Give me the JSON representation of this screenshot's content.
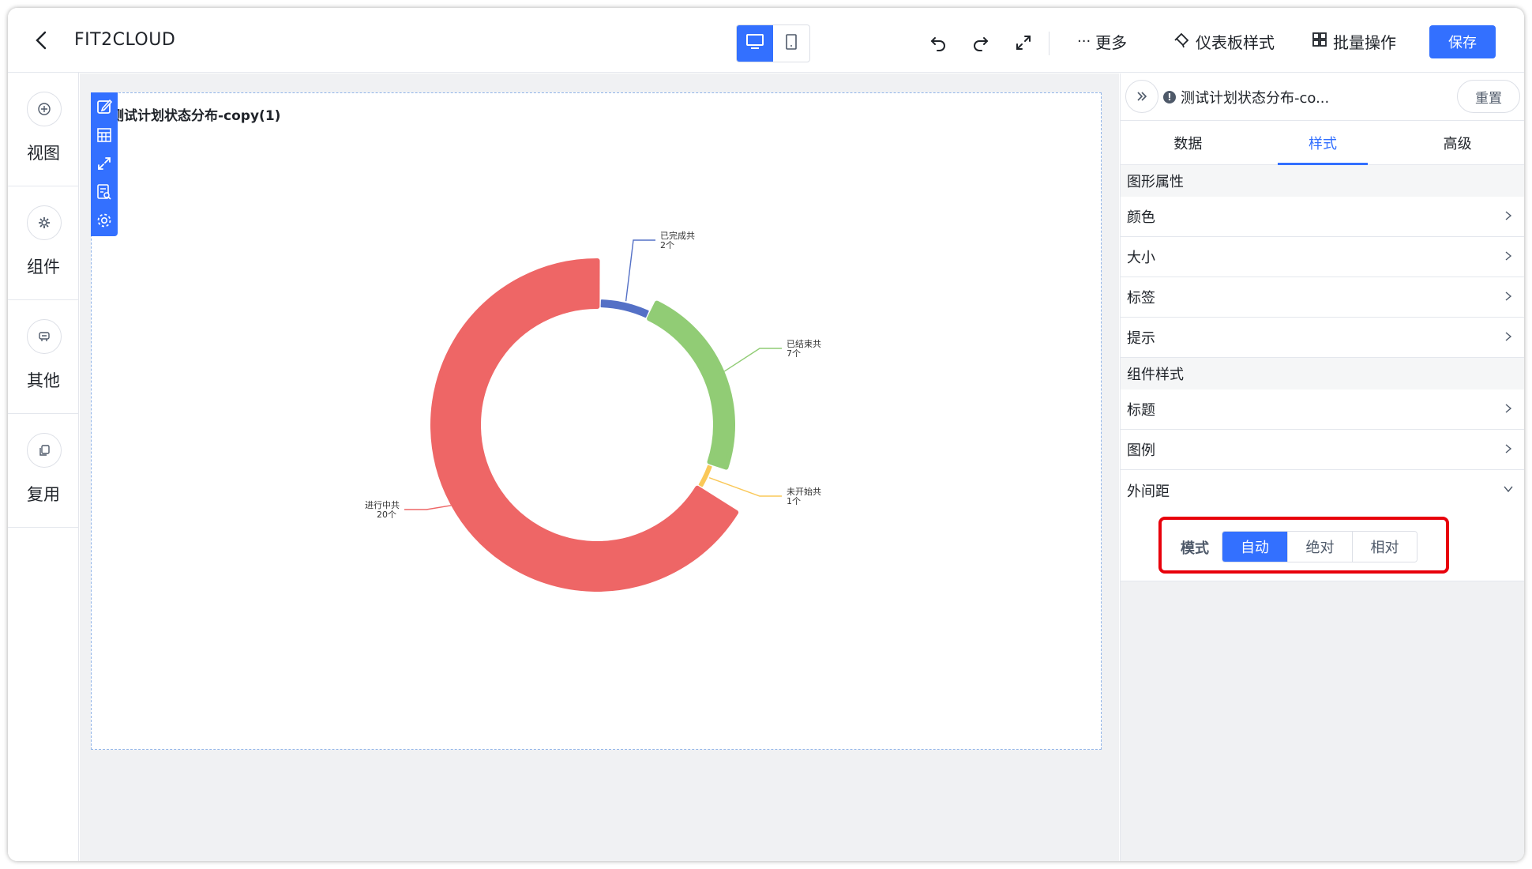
{
  "header": {
    "app_title": "FIT2CLOUD",
    "more_label": "更多",
    "dashboard_style_label": "仪表板样式",
    "batch_label": "批量操作",
    "save_label": "保存"
  },
  "sidebar": {
    "items": [
      {
        "label": "视图",
        "icon": "plus-circle-icon"
      },
      {
        "label": "组件",
        "icon": "gear-icon"
      },
      {
        "label": "其他",
        "icon": "chip-icon"
      },
      {
        "label": "复用",
        "icon": "copy-icon"
      }
    ]
  },
  "chart": {
    "title": "测试计划状态分布-copy(1)",
    "labels": {
      "completed": {
        "name": "已完成共",
        "count": "2个"
      },
      "finished": {
        "name": "已结束共",
        "count": "7个"
      },
      "not_started": {
        "name": "未开始共",
        "count": "1个"
      },
      "in_progress": {
        "name": "进行中共",
        "count": "20个"
      }
    }
  },
  "chart_data": {
    "type": "pie",
    "title": "测试计划状态分布-copy(1)",
    "series": [
      {
        "name": "已完成共",
        "value": 2,
        "color": "#5470c6"
      },
      {
        "name": "已结束共",
        "value": 7,
        "color": "#91cc75"
      },
      {
        "name": "未开始共",
        "value": 1,
        "color": "#fac858"
      },
      {
        "name": "进行中共",
        "value": 20,
        "color": "#ee6666"
      }
    ]
  },
  "panel": {
    "title": "测试计划状态分布-co...",
    "reset_label": "重置",
    "tabs": [
      "数据",
      "样式",
      "高级"
    ],
    "active_tab": "样式",
    "section_graph": "图形属性",
    "rows_graph": [
      "颜色",
      "大小",
      "标签",
      "提示"
    ],
    "section_component": "组件样式",
    "rows_component": [
      "标题",
      "图例",
      "外间距"
    ],
    "margin": {
      "mode_label": "模式",
      "options": [
        "自动",
        "绝对",
        "相对"
      ],
      "selected": "自动"
    }
  },
  "colors": {
    "accent": "#3370ff",
    "highlight": "#e8000b"
  }
}
